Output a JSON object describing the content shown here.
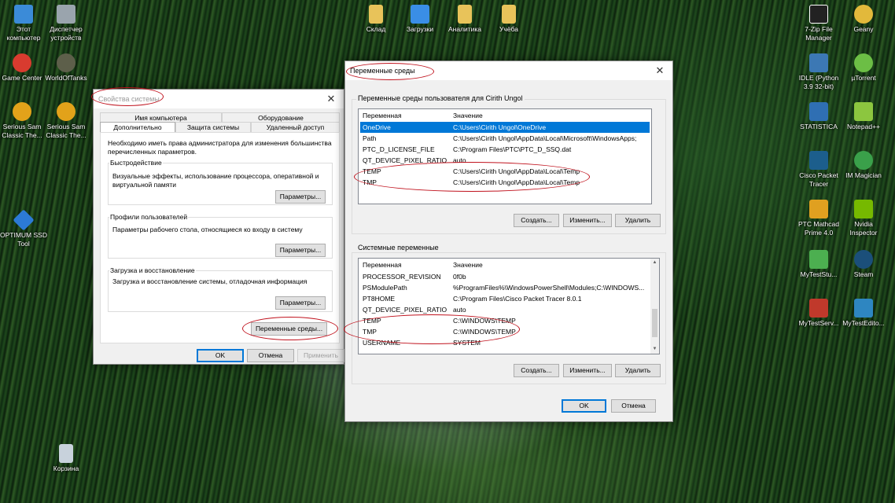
{
  "desktop": {
    "left_icons": [
      {
        "label": "Этот компьютер",
        "icon": "this-pc-icon",
        "color": "#3b8bd8"
      },
      {
        "label": "Диспетчер устройств",
        "icon": "device-manager-icon",
        "color": "#9aa4ad"
      },
      {
        "label": "Game Center",
        "icon": "game-center-icon",
        "color": "#d83b2f"
      },
      {
        "label": "WorldOfTanks",
        "icon": "world-of-tanks-icon",
        "color": "#5d5f4a"
      },
      {
        "label": "Serious Sam Classic The...",
        "icon": "serious-sam-icon",
        "color": "#e2a21a"
      },
      {
        "label": "Serious Sam Classic The...",
        "icon": "serious-sam-icon",
        "color": "#e2a21a"
      },
      {
        "label": "OPTIMUM SSD Tool",
        "icon": "ssd-tool-icon",
        "color": "#2c7ad6"
      },
      {
        "label": "Корзина",
        "icon": "recycle-bin-icon",
        "color": "#c8d2dc"
      }
    ],
    "top_icons": [
      {
        "label": "Склад",
        "icon": "folder-icon",
        "color": "#e8c35a"
      },
      {
        "label": "Загрузки",
        "icon": "downloads-folder-icon",
        "color": "#3a8ee6"
      },
      {
        "label": "Аналитика",
        "icon": "folder-icon",
        "color": "#e8c35a"
      },
      {
        "label": "Учёба",
        "icon": "folder-icon",
        "color": "#e8c35a"
      }
    ],
    "right_icons": [
      {
        "label": "7-Zip File Manager",
        "icon": "seven-zip-icon",
        "color": "#222222"
      },
      {
        "label": "Geany",
        "icon": "geany-icon",
        "color": "#e2b93b"
      },
      {
        "label": "IDLE (Python 3.9 32-bit)",
        "icon": "python-idle-icon",
        "color": "#3c78b4"
      },
      {
        "label": "µTorrent",
        "icon": "utorrent-icon",
        "color": "#6cbe45"
      },
      {
        "label": "STATISTICA",
        "icon": "statistica-icon",
        "color": "#2f6fb3"
      },
      {
        "label": "Notepad++",
        "icon": "notepad-plus-icon",
        "color": "#8cc63f"
      },
      {
        "label": "Cisco Packet Tracer",
        "icon": "packet-tracer-icon",
        "color": "#1c5e8c"
      },
      {
        "label": "IM Magician",
        "icon": "im-magician-icon",
        "color": "#3aa04a"
      },
      {
        "label": "PTC Mathcad Prime 4.0",
        "icon": "mathcad-icon",
        "color": "#e0a020"
      },
      {
        "label": "Nvidia Inspector",
        "icon": "nvidia-inspector-icon",
        "color": "#76b900"
      },
      {
        "label": "MyTestStu...",
        "icon": "mytest-student-icon",
        "color": "#4caf50"
      },
      {
        "label": "Steam",
        "icon": "steam-icon",
        "color": "#1b4f7a"
      },
      {
        "label": "MyTestServ...",
        "icon": "mytest-server-icon",
        "color": "#c0392b"
      },
      {
        "label": "MyTestEdito...",
        "icon": "mytest-editor-icon",
        "color": "#2e86c1"
      }
    ]
  },
  "sysprops": {
    "title": "Свойства системы",
    "tabs_top": [
      "Имя компьютера",
      "Оборудование"
    ],
    "tabs_bottom": [
      "Дополнительно",
      "Защита системы",
      "Удаленный доступ"
    ],
    "admin_note": "Необходимо иметь права администратора для изменения большинства перечисленных параметров.",
    "performance": {
      "label": "Быстродействие",
      "text": "Визуальные эффекты, использование процессора, оперативной и виртуальной памяти",
      "button": "Параметры..."
    },
    "profiles": {
      "label": "Профили пользователей",
      "text": "Параметры рабочего стола, относящиеся ко входу в систему",
      "button": "Параметры..."
    },
    "startup": {
      "label": "Загрузка и восстановление",
      "text": "Загрузка и восстановление системы, отладочная информация",
      "button": "Параметры..."
    },
    "env_button": "Переменные среды...",
    "ok": "OK",
    "cancel": "Отмена",
    "apply": "Применить"
  },
  "envvars": {
    "title": "Переменные среды",
    "user_section": "Переменные среды пользователя для Cirith Ungol",
    "col_var": "Переменная",
    "col_val": "Значение",
    "user_vars": [
      {
        "name": "OneDrive",
        "value": "C:\\Users\\Cirith Ungol\\OneDrive"
      },
      {
        "name": "Path",
        "value": "C:\\Users\\Cirith Ungol\\AppData\\Local\\Microsoft\\WindowsApps;"
      },
      {
        "name": "PTC_D_LICENSE_FILE",
        "value": "C:\\Program Files\\PTC\\PTC_D_SSQ.dat"
      },
      {
        "name": "QT_DEVICE_PIXEL_RATIO",
        "value": "auto"
      },
      {
        "name": "TEMP",
        "value": "C:\\Users\\Cirith Ungol\\AppData\\Local\\Temp"
      },
      {
        "name": "TMP",
        "value": "C:\\Users\\Cirith Ungol\\AppData\\Local\\Temp"
      }
    ],
    "system_section": "Системные переменные",
    "system_vars": [
      {
        "name": "PROCESSOR_REVISION",
        "value": "0f0b"
      },
      {
        "name": "PSModulePath",
        "value": "%ProgramFiles%\\WindowsPowerShell\\Modules;C:\\WINDOWS..."
      },
      {
        "name": "PT8HOME",
        "value": "C:\\Program Files\\Cisco Packet Tracer 8.0.1"
      },
      {
        "name": "QT_DEVICE_PIXEL_RATIO",
        "value": "auto"
      },
      {
        "name": "TEMP",
        "value": "C:\\WINDOWS\\TEMP"
      },
      {
        "name": "TMP",
        "value": "C:\\WINDOWS\\TEMP"
      },
      {
        "name": "USERNAME",
        "value": "SYSTEM"
      }
    ],
    "create": "Создать...",
    "edit": "Изменить...",
    "delete": "Удалить",
    "ok": "OK",
    "cancel": "Отмена"
  },
  "colors": {
    "selection": "#0078d7",
    "annotation": "#c0121d"
  }
}
